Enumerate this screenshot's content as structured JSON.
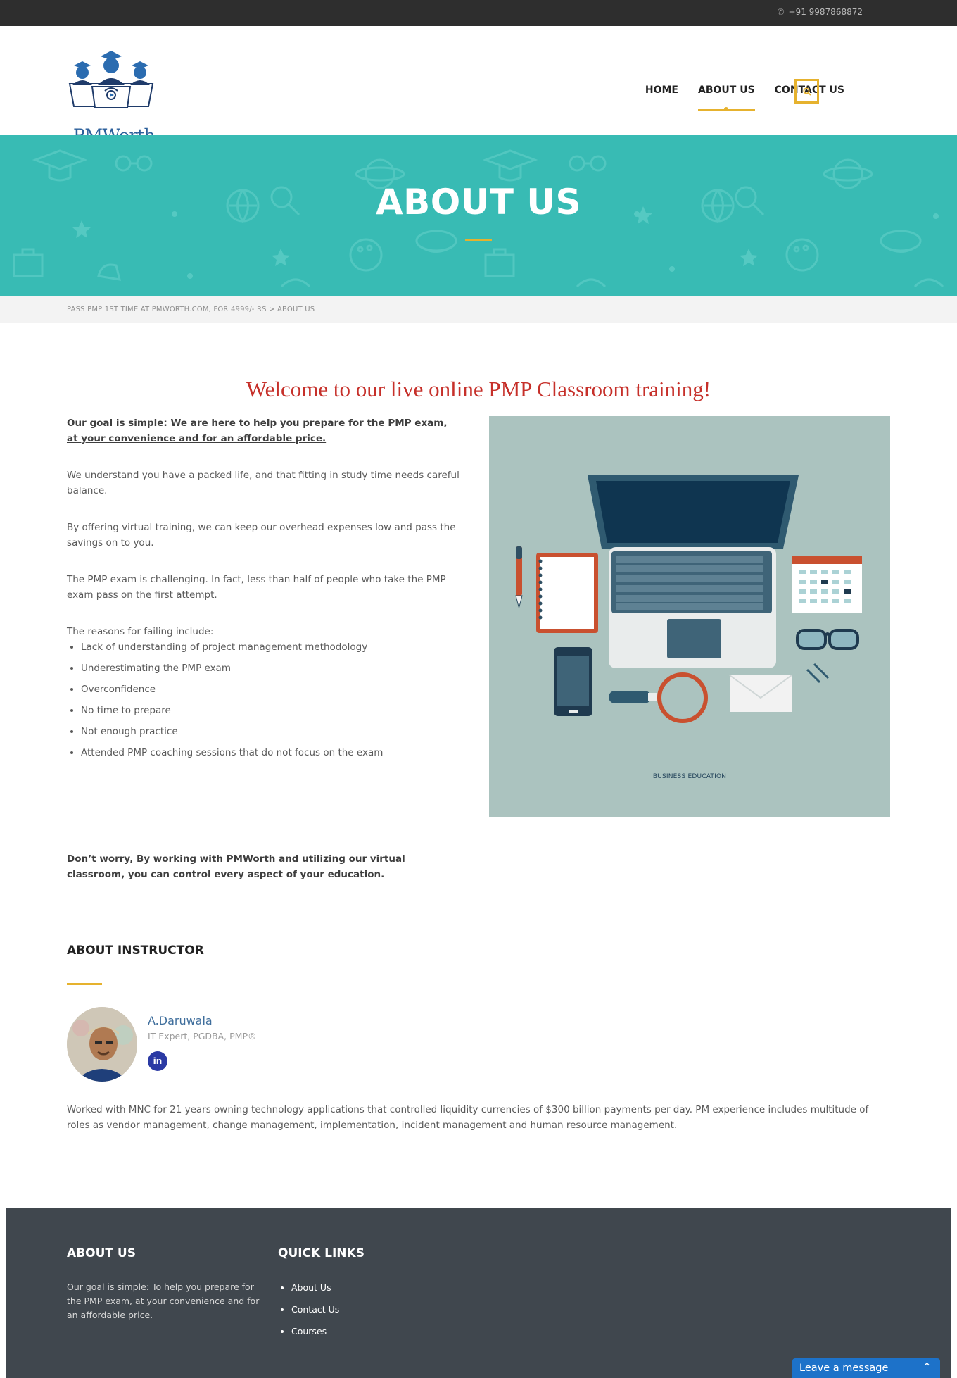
{
  "topbar": {
    "phone": "+91 9987868872",
    "phone_icon": "phone-icon"
  },
  "header": {
    "logo_text": "PMWorth",
    "nav": [
      "HOME",
      "ABOUT US",
      "CONTACT US"
    ],
    "active_nav": "ABOUT US",
    "search_icon": "search-icon"
  },
  "hero": {
    "title": "ABOUT US"
  },
  "breadcrumb": {
    "text": "PASS PMP 1ST TIME AT PMWORTH.COM, FOR 4999/- RS > ABOUT US"
  },
  "content": {
    "welcome": "Welcome to our live online PMP Classroom training!",
    "goal": "Our goal is simple: We are here to help you prepare for the PMP exam, at your convenience and for an affordable price.",
    "p1": "We understand you have a packed life, and that fitting in study time needs careful balance.",
    "p2": "By offering virtual training, we can keep our overhead expenses low and pass the savings on to you.",
    "p3": "The PMP exam is challenging. In fact, less than half of people who take the PMP exam pass on the first attempt.",
    "reasons_intro": "The reasons for failing include:",
    "reasons": [
      "Lack of understanding of project management methodology",
      "Underestimating the PMP exam",
      "Overconfidence",
      "No time to prepare",
      "Not enough practice",
      "Attended PMP coaching sessions that do not focus on the exam"
    ],
    "dont_worry_lead": "Don’t worry",
    "dont_worry_rest": ", By working with PMWorth and utilizing our virtual classroom, you can control every aspect of your education.",
    "illustration_caption": "BUSINESS EDUCATION"
  },
  "instructor": {
    "section_title": "ABOUT INSTRUCTOR",
    "name": "A.Daruwala",
    "credentials": "IT Expert, PGDBA, PMP®",
    "social": "in",
    "bio": "Worked with MNC for 21 years owning technology applications that controlled liquidity currencies of $300 billion payments per day. PM experience includes multitude of roles as vendor management, change management, implementation, incident management and human resource management."
  },
  "footer": {
    "about_title": "ABOUT US",
    "about_text": "Our goal is simple: To help you prepare for the PMP exam, at your convenience and for an affordable price.",
    "quick_title": "QUICK LINKS",
    "links": [
      "About Us",
      "Contact Us",
      "Courses"
    ]
  },
  "chat": {
    "label": "Leave a message"
  },
  "colors": {
    "accent": "#e6b22e",
    "teal": "#38bbb4",
    "headline": "#c6302a",
    "footer": "#40474e",
    "topbar": "#2e2e2e"
  }
}
